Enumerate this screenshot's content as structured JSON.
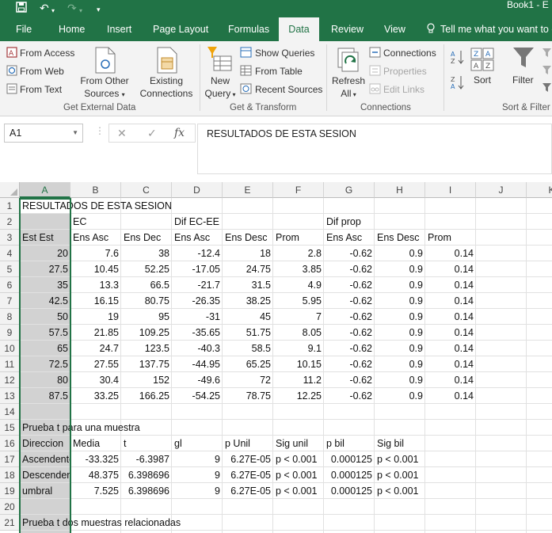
{
  "window": {
    "title": "Book1 - E"
  },
  "quick_access": {
    "save_icon": "save-icon",
    "undo_icon": "undo-icon",
    "redo_icon": "redo-icon",
    "customize_icon": "chevron-down-icon"
  },
  "tabs": [
    "File",
    "Home",
    "Insert",
    "Page Layout",
    "Formulas",
    "Data",
    "Review",
    "View"
  ],
  "tell_me": "Tell me what you want to d",
  "active_tab": "Data",
  "ribbon": {
    "get_external_data": {
      "label": "Get External Data",
      "from_access": "From Access",
      "from_web": "From Web",
      "from_text": "From Text",
      "from_other_l1": "From Other",
      "from_other_l2": "Sources",
      "existing_l1": "Existing",
      "existing_l2": "Connections"
    },
    "get_transform": {
      "label": "Get & Transform",
      "new_query_l1": "New",
      "new_query_l2": "Query",
      "show_queries": "Show Queries",
      "from_table": "From Table",
      "recent_sources": "Recent Sources"
    },
    "connections": {
      "label": "Connections",
      "refresh_l1": "Refresh",
      "refresh_l2": "All",
      "connections": "Connections",
      "properties": "Properties",
      "edit_links": "Edit Links"
    },
    "sort_filter": {
      "label": "Sort & Filter",
      "sort": "Sort",
      "filter": "Filter"
    }
  },
  "formula_bar": {
    "name_box": "A1",
    "cancel": "✕",
    "enter": "✓",
    "fx": "fx",
    "content": "RESULTADOS DE ESTA SESION"
  },
  "sheet": {
    "columns": [
      "A",
      "B",
      "C",
      "D",
      "E",
      "F",
      "G",
      "H",
      "I",
      "J",
      "K"
    ],
    "rows": [
      "1",
      "2",
      "3",
      "4",
      "5",
      "6",
      "7",
      "8",
      "9",
      "10",
      "11",
      "12",
      "13",
      "14",
      "15",
      "16",
      "17",
      "18",
      "19",
      "20",
      "21"
    ],
    "cells": [
      {
        "r": 1,
        "c": "A",
        "v": "RESULTADOS DE ESTA SESION"
      },
      {
        "r": 2,
        "c": "B",
        "v": "EC"
      },
      {
        "r": 2,
        "c": "D",
        "v": "Dif EC-EE"
      },
      {
        "r": 2,
        "c": "G",
        "v": "Dif prop"
      },
      {
        "r": 3,
        "c": "A",
        "v": "Est Est"
      },
      {
        "r": 3,
        "c": "B",
        "v": "Ens Asc"
      },
      {
        "r": 3,
        "c": "C",
        "v": "Ens Dec"
      },
      {
        "r": 3,
        "c": "D",
        "v": "Ens Asc"
      },
      {
        "r": 3,
        "c": "E",
        "v": "Ens Desc"
      },
      {
        "r": 3,
        "c": "F",
        "v": "Prom"
      },
      {
        "r": 3,
        "c": "G",
        "v": "Ens Asc"
      },
      {
        "r": 3,
        "c": "H",
        "v": "Ens Desc"
      },
      {
        "r": 3,
        "c": "I",
        "v": "Prom"
      },
      {
        "r": 4,
        "c": "A",
        "v": "20",
        "n": true
      },
      {
        "r": 4,
        "c": "B",
        "v": "7.6",
        "n": true
      },
      {
        "r": 4,
        "c": "C",
        "v": "38",
        "n": true
      },
      {
        "r": 4,
        "c": "D",
        "v": "-12.4",
        "n": true
      },
      {
        "r": 4,
        "c": "E",
        "v": "18",
        "n": true
      },
      {
        "r": 4,
        "c": "F",
        "v": "2.8",
        "n": true
      },
      {
        "r": 4,
        "c": "G",
        "v": "-0.62",
        "n": true
      },
      {
        "r": 4,
        "c": "H",
        "v": "0.9",
        "n": true
      },
      {
        "r": 4,
        "c": "I",
        "v": "0.14",
        "n": true
      },
      {
        "r": 5,
        "c": "A",
        "v": "27.5",
        "n": true
      },
      {
        "r": 5,
        "c": "B",
        "v": "10.45",
        "n": true
      },
      {
        "r": 5,
        "c": "C",
        "v": "52.25",
        "n": true
      },
      {
        "r": 5,
        "c": "D",
        "v": "-17.05",
        "n": true
      },
      {
        "r": 5,
        "c": "E",
        "v": "24.75",
        "n": true
      },
      {
        "r": 5,
        "c": "F",
        "v": "3.85",
        "n": true
      },
      {
        "r": 5,
        "c": "G",
        "v": "-0.62",
        "n": true
      },
      {
        "r": 5,
        "c": "H",
        "v": "0.9",
        "n": true
      },
      {
        "r": 5,
        "c": "I",
        "v": "0.14",
        "n": true
      },
      {
        "r": 6,
        "c": "A",
        "v": "35",
        "n": true
      },
      {
        "r": 6,
        "c": "B",
        "v": "13.3",
        "n": true
      },
      {
        "r": 6,
        "c": "C",
        "v": "66.5",
        "n": true
      },
      {
        "r": 6,
        "c": "D",
        "v": "-21.7",
        "n": true
      },
      {
        "r": 6,
        "c": "E",
        "v": "31.5",
        "n": true
      },
      {
        "r": 6,
        "c": "F",
        "v": "4.9",
        "n": true
      },
      {
        "r": 6,
        "c": "G",
        "v": "-0.62",
        "n": true
      },
      {
        "r": 6,
        "c": "H",
        "v": "0.9",
        "n": true
      },
      {
        "r": 6,
        "c": "I",
        "v": "0.14",
        "n": true
      },
      {
        "r": 7,
        "c": "A",
        "v": "42.5",
        "n": true
      },
      {
        "r": 7,
        "c": "B",
        "v": "16.15",
        "n": true
      },
      {
        "r": 7,
        "c": "C",
        "v": "80.75",
        "n": true
      },
      {
        "r": 7,
        "c": "D",
        "v": "-26.35",
        "n": true
      },
      {
        "r": 7,
        "c": "E",
        "v": "38.25",
        "n": true
      },
      {
        "r": 7,
        "c": "F",
        "v": "5.95",
        "n": true
      },
      {
        "r": 7,
        "c": "G",
        "v": "-0.62",
        "n": true
      },
      {
        "r": 7,
        "c": "H",
        "v": "0.9",
        "n": true
      },
      {
        "r": 7,
        "c": "I",
        "v": "0.14",
        "n": true
      },
      {
        "r": 8,
        "c": "A",
        "v": "50",
        "n": true
      },
      {
        "r": 8,
        "c": "B",
        "v": "19",
        "n": true
      },
      {
        "r": 8,
        "c": "C",
        "v": "95",
        "n": true
      },
      {
        "r": 8,
        "c": "D",
        "v": "-31",
        "n": true
      },
      {
        "r": 8,
        "c": "E",
        "v": "45",
        "n": true
      },
      {
        "r": 8,
        "c": "F",
        "v": "7",
        "n": true
      },
      {
        "r": 8,
        "c": "G",
        "v": "-0.62",
        "n": true
      },
      {
        "r": 8,
        "c": "H",
        "v": "0.9",
        "n": true
      },
      {
        "r": 8,
        "c": "I",
        "v": "0.14",
        "n": true
      },
      {
        "r": 9,
        "c": "A",
        "v": "57.5",
        "n": true
      },
      {
        "r": 9,
        "c": "B",
        "v": "21.85",
        "n": true
      },
      {
        "r": 9,
        "c": "C",
        "v": "109.25",
        "n": true
      },
      {
        "r": 9,
        "c": "D",
        "v": "-35.65",
        "n": true
      },
      {
        "r": 9,
        "c": "E",
        "v": "51.75",
        "n": true
      },
      {
        "r": 9,
        "c": "F",
        "v": "8.05",
        "n": true
      },
      {
        "r": 9,
        "c": "G",
        "v": "-0.62",
        "n": true
      },
      {
        "r": 9,
        "c": "H",
        "v": "0.9",
        "n": true
      },
      {
        "r": 9,
        "c": "I",
        "v": "0.14",
        "n": true
      },
      {
        "r": 10,
        "c": "A",
        "v": "65",
        "n": true
      },
      {
        "r": 10,
        "c": "B",
        "v": "24.7",
        "n": true
      },
      {
        "r": 10,
        "c": "C",
        "v": "123.5",
        "n": true
      },
      {
        "r": 10,
        "c": "D",
        "v": "-40.3",
        "n": true
      },
      {
        "r": 10,
        "c": "E",
        "v": "58.5",
        "n": true
      },
      {
        "r": 10,
        "c": "F",
        "v": "9.1",
        "n": true
      },
      {
        "r": 10,
        "c": "G",
        "v": "-0.62",
        "n": true
      },
      {
        "r": 10,
        "c": "H",
        "v": "0.9",
        "n": true
      },
      {
        "r": 10,
        "c": "I",
        "v": "0.14",
        "n": true
      },
      {
        "r": 11,
        "c": "A",
        "v": "72.5",
        "n": true
      },
      {
        "r": 11,
        "c": "B",
        "v": "27.55",
        "n": true
      },
      {
        "r": 11,
        "c": "C",
        "v": "137.75",
        "n": true
      },
      {
        "r": 11,
        "c": "D",
        "v": "-44.95",
        "n": true
      },
      {
        "r": 11,
        "c": "E",
        "v": "65.25",
        "n": true
      },
      {
        "r": 11,
        "c": "F",
        "v": "10.15",
        "n": true
      },
      {
        "r": 11,
        "c": "G",
        "v": "-0.62",
        "n": true
      },
      {
        "r": 11,
        "c": "H",
        "v": "0.9",
        "n": true
      },
      {
        "r": 11,
        "c": "I",
        "v": "0.14",
        "n": true
      },
      {
        "r": 12,
        "c": "A",
        "v": "80",
        "n": true
      },
      {
        "r": 12,
        "c": "B",
        "v": "30.4",
        "n": true
      },
      {
        "r": 12,
        "c": "C",
        "v": "152",
        "n": true
      },
      {
        "r": 12,
        "c": "D",
        "v": "-49.6",
        "n": true
      },
      {
        "r": 12,
        "c": "E",
        "v": "72",
        "n": true
      },
      {
        "r": 12,
        "c": "F",
        "v": "11.2",
        "n": true
      },
      {
        "r": 12,
        "c": "G",
        "v": "-0.62",
        "n": true
      },
      {
        "r": 12,
        "c": "H",
        "v": "0.9",
        "n": true
      },
      {
        "r": 12,
        "c": "I",
        "v": "0.14",
        "n": true
      },
      {
        "r": 13,
        "c": "A",
        "v": "87.5",
        "n": true
      },
      {
        "r": 13,
        "c": "B",
        "v": "33.25",
        "n": true
      },
      {
        "r": 13,
        "c": "C",
        "v": "166.25",
        "n": true
      },
      {
        "r": 13,
        "c": "D",
        "v": "-54.25",
        "n": true
      },
      {
        "r": 13,
        "c": "E",
        "v": "78.75",
        "n": true
      },
      {
        "r": 13,
        "c": "F",
        "v": "12.25",
        "n": true
      },
      {
        "r": 13,
        "c": "G",
        "v": "-0.62",
        "n": true
      },
      {
        "r": 13,
        "c": "H",
        "v": "0.9",
        "n": true
      },
      {
        "r": 13,
        "c": "I",
        "v": "0.14",
        "n": true
      },
      {
        "r": 15,
        "c": "A",
        "v": "Prueba t para una muestra"
      },
      {
        "r": 16,
        "c": "A",
        "v": "Direccion"
      },
      {
        "r": 16,
        "c": "B",
        "v": "Media"
      },
      {
        "r": 16,
        "c": "C",
        "v": "t"
      },
      {
        "r": 16,
        "c": "D",
        "v": "gl"
      },
      {
        "r": 16,
        "c": "E",
        "v": "p Unil"
      },
      {
        "r": 16,
        "c": "F",
        "v": "Sig unil"
      },
      {
        "r": 16,
        "c": "G",
        "v": "p bil"
      },
      {
        "r": 16,
        "c": "H",
        "v": "Sig bil"
      },
      {
        "r": 17,
        "c": "A",
        "v": "Ascendente",
        "clip": true
      },
      {
        "r": 17,
        "c": "B",
        "v": "-33.325",
        "n": true
      },
      {
        "r": 17,
        "c": "C",
        "v": "-6.3987",
        "n": true
      },
      {
        "r": 17,
        "c": "D",
        "v": "9",
        "n": true
      },
      {
        "r": 17,
        "c": "E",
        "v": "6.27E-05",
        "n": true
      },
      {
        "r": 17,
        "c": "F",
        "v": "p < 0.001"
      },
      {
        "r": 17,
        "c": "G",
        "v": "0.000125",
        "n": true
      },
      {
        "r": 17,
        "c": "H",
        "v": "p < 0.001"
      },
      {
        "r": 18,
        "c": "A",
        "v": "Descendente",
        "clip": true
      },
      {
        "r": 18,
        "c": "B",
        "v": "48.375",
        "n": true
      },
      {
        "r": 18,
        "c": "C",
        "v": "6.398696",
        "n": true
      },
      {
        "r": 18,
        "c": "D",
        "v": "9",
        "n": true
      },
      {
        "r": 18,
        "c": "E",
        "v": "6.27E-05",
        "n": true
      },
      {
        "r": 18,
        "c": "F",
        "v": "p < 0.001"
      },
      {
        "r": 18,
        "c": "G",
        "v": "0.000125",
        "n": true
      },
      {
        "r": 18,
        "c": "H",
        "v": "p < 0.001"
      },
      {
        "r": 19,
        "c": "A",
        "v": "umbral"
      },
      {
        "r": 19,
        "c": "B",
        "v": "7.525",
        "n": true
      },
      {
        "r": 19,
        "c": "C",
        "v": "6.398696",
        "n": true
      },
      {
        "r": 19,
        "c": "D",
        "v": "9",
        "n": true
      },
      {
        "r": 19,
        "c": "E",
        "v": "6.27E-05",
        "n": true
      },
      {
        "r": 19,
        "c": "F",
        "v": "p < 0.001"
      },
      {
        "r": 19,
        "c": "G",
        "v": "0.000125",
        "n": true
      },
      {
        "r": 19,
        "c": "H",
        "v": "p < 0.001"
      },
      {
        "r": 21,
        "c": "A",
        "v": "Prueba t dos muestras relacionadas"
      }
    ]
  },
  "colors": {
    "accent": "#217346",
    "selection_shade": "#d2d2d2"
  }
}
